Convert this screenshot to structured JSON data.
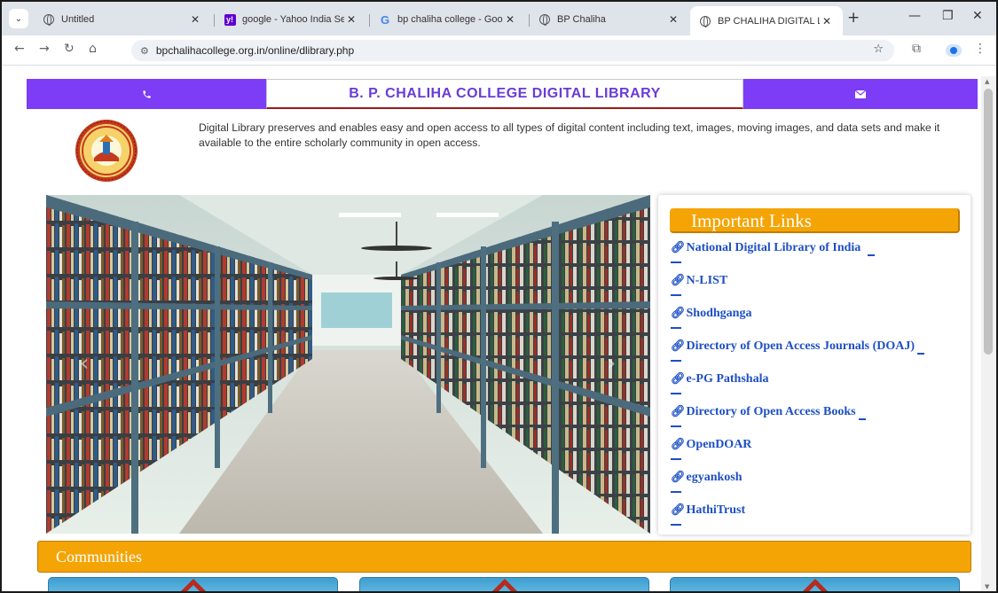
{
  "browser": {
    "tabs": [
      {
        "label": "Untitled",
        "icon": "globe-icon",
        "active": false
      },
      {
        "label": "google - Yahoo India Search Re",
        "icon": "yahoo-icon",
        "active": false
      },
      {
        "label": "bp chaliha college - Google Se",
        "icon": "google-icon",
        "active": false
      },
      {
        "label": "BP Chaliha",
        "icon": "globe-icon",
        "active": false
      },
      {
        "label": "BP CHALIHA DIGITAL LIBRARY",
        "icon": "globe-icon",
        "active": true
      }
    ],
    "url": "bpchalihacollege.org.in/online/dlibrary.php",
    "yahoo_glyph": "y!",
    "google_glyph": "G"
  },
  "header": {
    "phone_icon": "phone-icon",
    "title": "B. P. CHALIHA COLLEGE DIGITAL LIBRARY",
    "mail_icon": "mail-icon"
  },
  "intro": {
    "text": "Digital Library preserves and enables easy and open access to all types of digital content including text, images, moving images, and data sets and make it available to the entire scholarly community in open access."
  },
  "important_links": {
    "title": "Important Links",
    "items": [
      "National Digital Library of India",
      "N-LIST",
      "Shodhganga",
      "Directory of Open Access Journals (DOAJ)",
      "e-PG Pathshala",
      "Directory of Open Access Books",
      "OpenDOAR",
      "egyankosh",
      "HathiTrust"
    ]
  },
  "communities": {
    "title": "Communities"
  },
  "colors": {
    "accent_purple": "#7d3cf5",
    "title_purple": "#6a3bd7",
    "orange": "#f4a405",
    "link_blue": "#1d4fc4"
  }
}
